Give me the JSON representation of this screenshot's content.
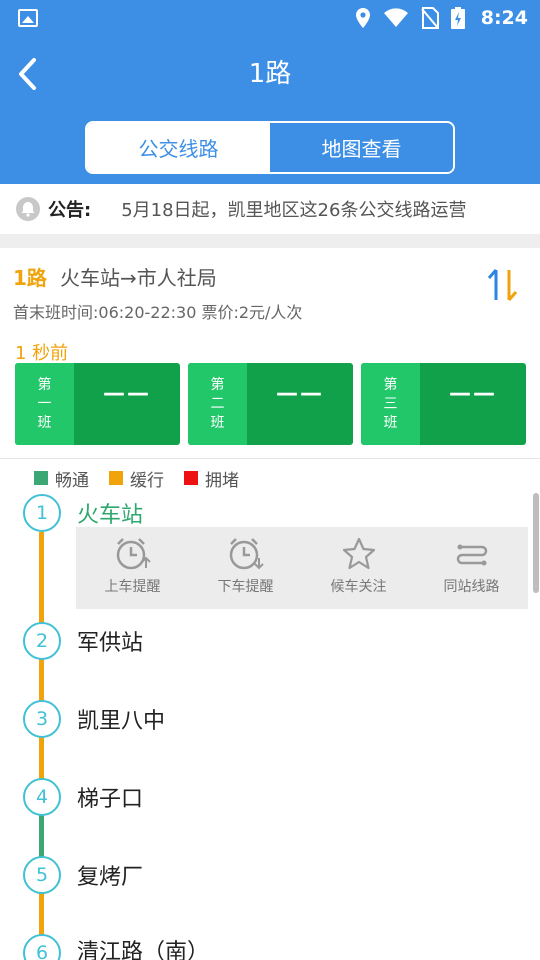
{
  "status_bar": {
    "time": "8:24"
  },
  "header": {
    "title": "1路",
    "tabs": [
      {
        "label": "公交线路",
        "active": true
      },
      {
        "label": "地图查看",
        "active": false
      }
    ]
  },
  "notice": {
    "label": "公告:",
    "text": "5月18日起，凯里地区这26条公交线路运营"
  },
  "route": {
    "number": "1路",
    "direction": "火车站→市人社局",
    "schedule": "首末班时间:06:20-22:30 票价:2元/人次",
    "updated": "1 秒前"
  },
  "buses": [
    {
      "label": [
        "第",
        "一",
        "班"
      ],
      "value": "——"
    },
    {
      "label": [
        "第",
        "二",
        "班"
      ],
      "value": "——"
    },
    {
      "label": [
        "第",
        "三",
        "班"
      ],
      "value": "——"
    }
  ],
  "legend": [
    {
      "label": "畅通",
      "color": "#3aa774"
    },
    {
      "label": "缓行",
      "color": "#f0a30a"
    },
    {
      "label": "拥堵",
      "color": "#ee1111"
    }
  ],
  "stops": [
    {
      "no": "1",
      "name": "火车站"
    },
    {
      "no": "2",
      "name": "军供站"
    },
    {
      "no": "3",
      "name": "凯里八中"
    },
    {
      "no": "4",
      "name": "梯子口"
    },
    {
      "no": "5",
      "name": "复烤厂"
    },
    {
      "no": "6",
      "name": "清江路（南）"
    }
  ],
  "stop_actions": [
    {
      "label": "上车提醒",
      "icon": "alarm-up-icon"
    },
    {
      "label": "下车提醒",
      "icon": "alarm-down-icon"
    },
    {
      "label": "候车关注",
      "icon": "star-icon"
    },
    {
      "label": "同站线路",
      "icon": "route-icon"
    }
  ],
  "colors": {
    "primary": "#3d8fe6",
    "accent": "#f0a30a",
    "bus_green": "#10a14a",
    "stop_cyan": "#41c1d6"
  }
}
